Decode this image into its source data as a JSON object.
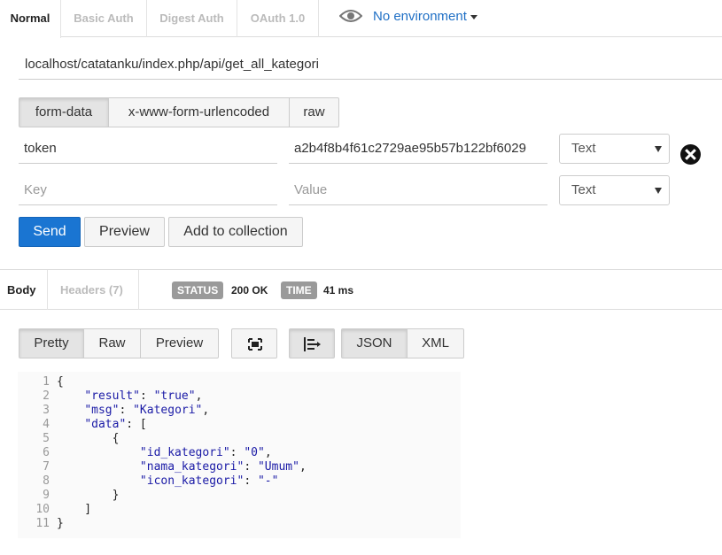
{
  "auth_tabs": [
    "Normal",
    "Basic Auth",
    "Digest Auth",
    "OAuth 1.0"
  ],
  "environment": "No environment",
  "url": "localhost/catatanku/index.php/api/get_all_kategori",
  "body_types": [
    "form-data",
    "x-www-form-urlencoded",
    "raw"
  ],
  "params": [
    {
      "key": "token",
      "value": "a2b4f8b4f61c2729ae95b57b122bf6029",
      "type": "Text"
    },
    {
      "key_placeholder": "Key",
      "value_placeholder": "Value",
      "type": "Text"
    }
  ],
  "actions": {
    "send": "Send",
    "preview": "Preview",
    "add_to_collection": "Add to collection"
  },
  "response": {
    "tabs": [
      "Body",
      "Headers (7)"
    ],
    "status_label": "STATUS",
    "status_value": "200 OK",
    "time_label": "TIME",
    "time_value": "41 ms",
    "view_modes": [
      "Pretty",
      "Raw",
      "Preview"
    ],
    "formats": [
      "JSON",
      "XML"
    ],
    "line_numbers": [
      "1",
      "2",
      "3",
      "4",
      "5",
      "6",
      "7",
      "8",
      "9",
      "10",
      "11"
    ],
    "body_lines": [
      "{",
      "    \"result\": \"true\",",
      "    \"msg\": \"Kategori\",",
      "    \"data\": [",
      "        {",
      "            \"id_kategori\": \"0\",",
      "            \"nama_kategori\": \"Umum\",",
      "            \"icon_kategori\": \"-\"",
      "        }",
      "    ]",
      "}"
    ]
  },
  "colors": {
    "accent": "#1a75d2",
    "link": "#1f6fc5",
    "badge": "#9a9a9a"
  }
}
